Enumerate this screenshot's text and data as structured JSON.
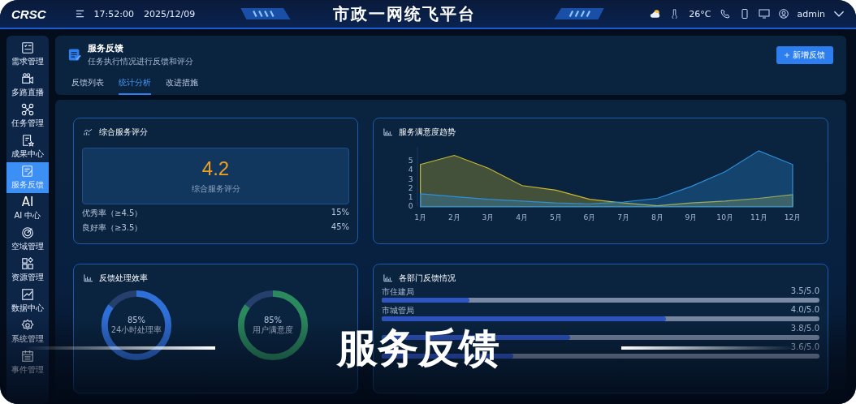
{
  "header": {
    "logo": "CRSC",
    "time": "17:52:00",
    "date": "2025/12/09",
    "title": "市政一网统飞平台",
    "temperature": "26°C",
    "user": "admin"
  },
  "sidebar": {
    "items": [
      {
        "label": "需求管理",
        "selected": false
      },
      {
        "label": "多路直播",
        "selected": false
      },
      {
        "label": "任务管理",
        "selected": false
      },
      {
        "label": "成果中心",
        "selected": false
      },
      {
        "label": "服务反馈",
        "selected": true
      },
      {
        "label": "AI 中心",
        "icon_text": "AI",
        "selected": false
      },
      {
        "label": "空域管理",
        "selected": false
      },
      {
        "label": "资源管理",
        "selected": false
      },
      {
        "label": "数据中心",
        "selected": false
      },
      {
        "label": "系统管理",
        "selected": false
      },
      {
        "label": "事件管理",
        "selected": false
      }
    ]
  },
  "page": {
    "title": "服务反馈",
    "subtitle": "任务执行情况进行反馈和评分",
    "add_button": "新增反馈",
    "tabs": [
      {
        "label": "反馈列表",
        "selected": false
      },
      {
        "label": "统计分析",
        "selected": true
      },
      {
        "label": "改进措施",
        "selected": false
      }
    ]
  },
  "score_card": {
    "title": "综合服务评分",
    "score": "4.2",
    "score_label": "综合服务评分",
    "rates": [
      {
        "label": "优秀率（≥4.5）",
        "value": "15%"
      },
      {
        "label": "良好率（≥3.5）",
        "value": "45%"
      }
    ]
  },
  "trend_card": {
    "title": "服务满意度趋势",
    "chart_data": {
      "type": "area",
      "categories": [
        "1月",
        "2月",
        "3月",
        "4月",
        "5月",
        "6月",
        "7月",
        "8月",
        "9月",
        "10月",
        "11月",
        "12月"
      ],
      "yticks": [
        0,
        1,
        2,
        3,
        4,
        5
      ],
      "ylim": [
        0,
        6.5
      ],
      "series": [
        {
          "color": "#c9b92e",
          "values": [
            4.6,
            5.6,
            4.2,
            2.3,
            1.8,
            0.8,
            0.4,
            0.1,
            0.4,
            0.6,
            0.9,
            1.3
          ]
        },
        {
          "color": "#2f8fd8",
          "values": [
            1.4,
            1.1,
            0.8,
            0.6,
            0.4,
            0.3,
            0.5,
            0.9,
            2.2,
            3.8,
            6.1,
            4.6
          ]
        }
      ]
    }
  },
  "efficiency_card": {
    "title": "反馈处理效率",
    "rings": [
      {
        "value": "85%",
        "label": "24小时处理率",
        "color": "#2f6fd8"
      },
      {
        "value": "85%",
        "label": "用户满意度",
        "color": "#2a8a5e"
      }
    ]
  },
  "department_card": {
    "title": "各部门反馈情况",
    "rows": [
      {
        "name": "市住建局",
        "value": "3.5/5.0",
        "level": 0.2
      },
      {
        "name": "市城管局",
        "value": "4.0/5.0",
        "level": 0.65
      },
      {
        "value": "3.8/5.0",
        "level": 0.43
      },
      {
        "value": "3.6/5.0",
        "level": 0.3
      }
    ]
  },
  "caption": "服务反馈"
}
